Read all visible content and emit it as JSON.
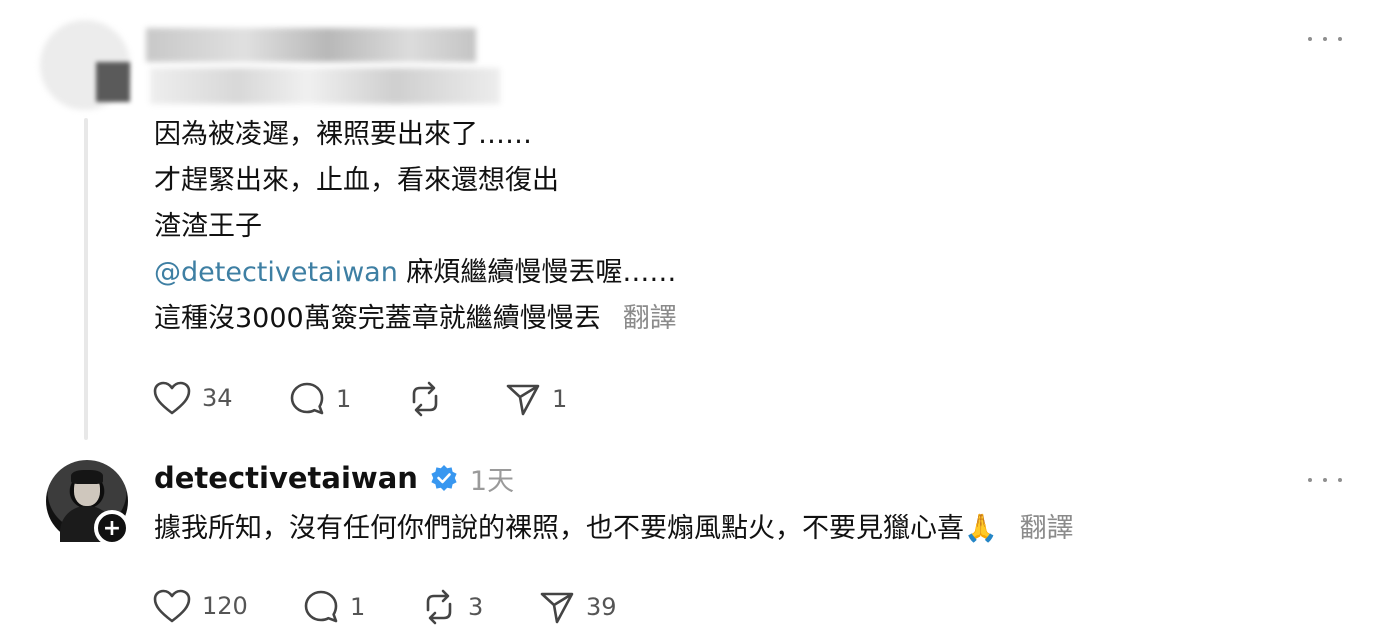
{
  "comment": {
    "lines": [
      "因為被凌遲，裸照要出來了……",
      "才趕緊出來，止血，看來還想復出",
      "渣渣王子"
    ],
    "mention": "@detectivetaiwan",
    "mention_rest": " 麻煩繼續慢慢丟喔……",
    "last_line": "這種沒3000萬簽完蓋章就繼續慢慢丟",
    "translate_label": "翻譯",
    "stats": {
      "likes": "34",
      "replies": "1",
      "shares": "1"
    }
  },
  "reply": {
    "username": "detectivetaiwan",
    "time": "1天",
    "text": "據我所知，沒有任何你們說的裸照，也不要煽風點火，不要見獵心喜🙏",
    "translate_label": "翻譯",
    "stats": {
      "likes": "120",
      "replies": "1",
      "reposts": "3",
      "shares": "39"
    }
  },
  "icons": {
    "verified_color": "#3897f0",
    "icon_color": "#444444"
  }
}
